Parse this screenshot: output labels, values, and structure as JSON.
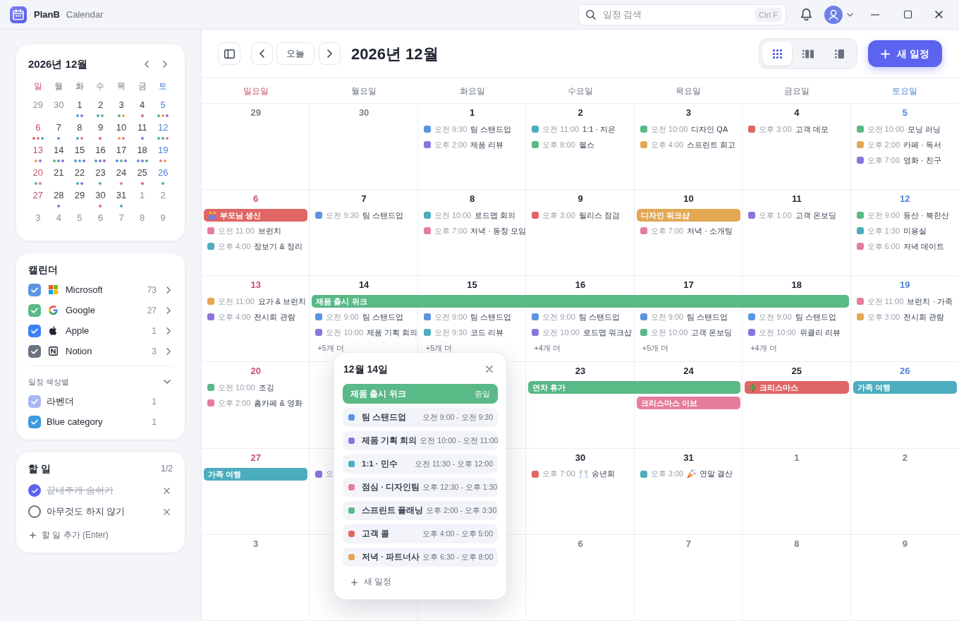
{
  "app": {
    "name": "PlanB",
    "subtitle": "Calendar"
  },
  "search": {
    "placeholder": "일정 검색",
    "shortcut": "Ctrl F"
  },
  "mini_calendar": {
    "title": "2026년 12월",
    "weekdays": [
      {
        "label": "일",
        "kind": "sunday"
      },
      {
        "label": "월",
        "kind": "weekday"
      },
      {
        "label": "화",
        "kind": "weekday"
      },
      {
        "label": "수",
        "kind": "weekday"
      },
      {
        "label": "목",
        "kind": "weekday"
      },
      {
        "label": "금",
        "kind": "weekday"
      },
      {
        "label": "토",
        "kind": "saturday"
      }
    ],
    "weeks": [
      [
        {
          "label": "29",
          "muted": true
        },
        {
          "label": "30",
          "muted": true
        },
        {
          "label": "1",
          "muted": false,
          "dots": [
            {
              "color": "#5b95e2"
            },
            {
              "color": "#8b74dd"
            }
          ]
        },
        {
          "label": "2",
          "muted": false,
          "dots": [
            {
              "color": "#4badbd"
            },
            {
              "color": "#59b987"
            }
          ]
        },
        {
          "label": "3",
          "muted": false,
          "dots": [
            {
              "color": "#59b987"
            },
            {
              "color": "#e2a854"
            }
          ]
        },
        {
          "label": "4",
          "muted": false,
          "dots": [
            {
              "color": "#e06666"
            }
          ]
        },
        {
          "label": "5",
          "muted": false,
          "dots": [
            {
              "color": "#59b987"
            },
            {
              "color": "#e2a854"
            },
            {
              "color": "#8b74dd"
            }
          ]
        }
      ],
      [
        {
          "label": "6",
          "muted": false,
          "dots": [
            {
              "color": "#e06666"
            },
            {
              "color": "#e67c9c"
            },
            {
              "color": "#4badbd"
            }
          ]
        },
        {
          "label": "7",
          "muted": false,
          "dots": [
            {
              "color": "#5b95e2"
            }
          ]
        },
        {
          "label": "8",
          "muted": false,
          "dots": [
            {
              "color": "#4badbd"
            },
            {
              "color": "#e67c9c"
            }
          ]
        },
        {
          "label": "9",
          "muted": false,
          "dots": [
            {
              "color": "#e06666"
            }
          ]
        },
        {
          "label": "10",
          "muted": false,
          "dots": [
            {
              "color": "#e2a854"
            },
            {
              "color": "#e67c9c"
            }
          ]
        },
        {
          "label": "11",
          "muted": false,
          "dots": [
            {
              "color": "#8b74dd"
            }
          ]
        },
        {
          "label": "12",
          "muted": false,
          "dots": [
            {
              "color": "#59b987"
            },
            {
              "color": "#4badbd"
            },
            {
              "color": "#e67c9c"
            }
          ]
        }
      ],
      [
        {
          "label": "13",
          "muted": false,
          "dots": [
            {
              "color": "#e2a854"
            },
            {
              "color": "#8b74dd"
            }
          ]
        },
        {
          "label": "14",
          "muted": false,
          "dots": [
            {
              "color": "#59b987"
            },
            {
              "color": "#5b95e2"
            },
            {
              "color": "#8b74dd"
            }
          ]
        },
        {
          "label": "15",
          "muted": false,
          "dots": [
            {
              "color": "#5b95e2"
            },
            {
              "color": "#4badbd"
            },
            {
              "color": "#8b74dd"
            }
          ]
        },
        {
          "label": "16",
          "muted": false,
          "dots": [
            {
              "color": "#5b95e2"
            },
            {
              "color": "#8b74dd"
            },
            {
              "color": "#8b74dd"
            }
          ]
        },
        {
          "label": "17",
          "muted": false,
          "dots": [
            {
              "color": "#5b95e2"
            },
            {
              "color": "#59b987"
            },
            {
              "color": "#8b74dd"
            }
          ]
        },
        {
          "label": "18",
          "muted": false,
          "dots": [
            {
              "color": "#5b95e2"
            },
            {
              "color": "#8b74dd"
            },
            {
              "color": "#4badbd"
            }
          ]
        },
        {
          "label": "19",
          "muted": false,
          "dots": [
            {
              "color": "#e67c9c"
            },
            {
              "color": "#e2a854"
            }
          ]
        }
      ],
      [
        {
          "label": "20",
          "muted": false,
          "dots": [
            {
              "color": "#59b987"
            },
            {
              "color": "#e67c9c"
            }
          ]
        },
        {
          "label": "21",
          "muted": false
        },
        {
          "label": "22",
          "muted": false,
          "dots": [
            {
              "color": "#4badbd"
            },
            {
              "color": "#8b74dd"
            }
          ]
        },
        {
          "label": "23",
          "muted": false,
          "dots": [
            {
              "color": "#59b987"
            }
          ]
        },
        {
          "label": "24",
          "muted": false,
          "dots": [
            {
              "color": "#e67c9c"
            }
          ]
        },
        {
          "label": "25",
          "muted": false,
          "dots": [
            {
              "color": "#e06666"
            }
          ]
        },
        {
          "label": "26",
          "muted": false,
          "dots": [
            {
              "color": "#4badbd"
            }
          ]
        }
      ],
      [
        {
          "label": "27",
          "muted": false
        },
        {
          "label": "28",
          "muted": false,
          "dots": [
            {
              "color": "#8b74dd"
            }
          ]
        },
        {
          "label": "29",
          "muted": false
        },
        {
          "label": "30",
          "muted": false,
          "dots": [
            {
              "color": "#e06666"
            }
          ]
        },
        {
          "label": "31",
          "muted": false,
          "dots": [
            {
              "color": "#4badbd"
            }
          ]
        },
        {
          "label": "1",
          "muted": true
        },
        {
          "label": "2",
          "muted": true
        }
      ],
      [
        {
          "label": "3",
          "muted": true
        },
        {
          "label": "4",
          "muted": true
        },
        {
          "label": "5",
          "muted": true
        },
        {
          "label": "6",
          "muted": true
        },
        {
          "label": "7",
          "muted": true
        },
        {
          "label": "8",
          "muted": true
        },
        {
          "label": "9",
          "muted": true
        }
      ]
    ]
  },
  "calendars": {
    "title": "캘린더",
    "accounts": [
      {
        "name": "Microsoft",
        "kind": "microsoft",
        "count": "73",
        "checked": true,
        "color": "#5b95e2"
      },
      {
        "name": "Google",
        "kind": "google",
        "count": "27",
        "checked": true,
        "color": "#59b987"
      },
      {
        "name": "Apple",
        "kind": "apple",
        "count": "1",
        "checked": true,
        "color": "#3b82f6"
      },
      {
        "name": "Notion",
        "kind": "notion",
        "count": "3",
        "checked": true,
        "color": "#6b7280"
      }
    ],
    "group": {
      "title": "일정 색상별",
      "expanded": true,
      "items": [
        {
          "name": "라벤더",
          "count": "1",
          "checked": true,
          "color": "#a9b6f4"
        },
        {
          "name": "Blue category",
          "count": "1",
          "checked": true,
          "color": "#3d9ae0"
        }
      ]
    }
  },
  "todo": {
    "title": "할 일",
    "progress": "1/2",
    "items": [
      {
        "text": "끝내주게 숨쉬기",
        "checked": true
      },
      {
        "text": "아무것도 하지 않기",
        "checked": false
      }
    ],
    "add_label": "할 일 추가 (Enter)"
  },
  "toolbar": {
    "today": "오늘",
    "title": "2026년 12월",
    "views": [
      {
        "kind": "month",
        "selected": true
      },
      {
        "kind": "week",
        "selected": false
      },
      {
        "kind": "day",
        "selected": false
      }
    ],
    "new_event": "새 일정"
  },
  "calendar": {
    "weekdays": [
      {
        "label": "일요일",
        "kind": "sunday"
      },
      {
        "label": "월요일",
        "kind": "weekday"
      },
      {
        "label": "화요일",
        "kind": "weekday"
      },
      {
        "label": "수요일",
        "kind": "weekday"
      },
      {
        "label": "목요일",
        "kind": "weekday"
      },
      {
        "label": "금요일",
        "kind": "weekday"
      },
      {
        "label": "토요일",
        "kind": "saturday"
      }
    ],
    "weeks": [
      {
        "sun": {
          "label": "29",
          "muted": true
        },
        "mon": {
          "label": "30",
          "muted": true
        },
        "tue": {
          "label": "1",
          "muted": false,
          "events": [
            {
              "time": "오전 9:30",
              "title": "팀 스탠드업",
              "color": "#5b95e2",
              "kind": "plain"
            },
            {
              "time": "오후 2:00",
              "title": "제품 리뷰",
              "color": "#8b74dd",
              "kind": "plain"
            }
          ]
        },
        "wed": {
          "label": "2",
          "muted": false,
          "events": [
            {
              "time": "오전 11:00",
              "title": "1:1 · 지은",
              "color": "#4badbd",
              "kind": "plain"
            },
            {
              "time": "오후 8:00",
              "title": "헬스",
              "color": "#59b987",
              "kind": "plain"
            }
          ]
        },
        "thu": {
          "label": "3",
          "muted": false,
          "events": [
            {
              "time": "오전 10:00",
              "title": "디자인 QA",
              "color": "#59b987",
              "kind": "plain"
            },
            {
              "time": "오후 4:00",
              "title": "스프린트 회고",
              "color": "#e2a854",
              "kind": "plain"
            }
          ]
        },
        "fri": {
          "label": "4",
          "muted": false,
          "events": [
            {
              "time": "오후 3:00",
              "title": "고객 데모",
              "color": "#e06666",
              "kind": "plain"
            }
          ]
        },
        "sat": {
          "label": "5",
          "muted": false,
          "events": [
            {
              "time": "오전 10:00",
              "title": "모닝 러닝",
              "color": "#59b987",
              "kind": "plain"
            },
            {
              "time": "오후 2:00",
              "title": "카페 · 독서",
              "color": "#e2a854",
              "kind": "plain"
            },
            {
              "time": "오후 7:00",
              "title": "영화 · 친구",
              "color": "#8b74dd",
              "kind": "plain"
            }
          ]
        }
      },
      {
        "sun": {
          "label": "6",
          "muted": false,
          "bars": [
            {
              "kind": "family",
              "title": "부모님 생신",
              "color": "#e06666"
            }
          ],
          "events": [
            {
              "time": "오전 11:00",
              "title": "브런치",
              "color": "#e67c9c",
              "kind": "plain"
            },
            {
              "time": "오후 4:00",
              "title": "장보기 & 정리",
              "color": "#4badbd",
              "kind": "plain"
            }
          ]
        },
        "mon": {
          "label": "7",
          "muted": false,
          "events": [
            {
              "time": "오전 9:30",
              "title": "팀 스탠드업",
              "color": "#5b95e2",
              "kind": "plain"
            }
          ]
        },
        "tue": {
          "label": "8",
          "muted": false,
          "events": [
            {
              "time": "오전 10:00",
              "title": "로드맵 회의",
              "color": "#4badbd",
              "kind": "plain"
            },
            {
              "time": "오후 7:00",
              "title": "저녁 · 동창 모임",
              "color": "#e67c9c",
              "kind": "plain"
            }
          ]
        },
        "wed": {
          "label": "9",
          "muted": false,
          "events": [
            {
              "time": "오후 3:00",
              "title": "릴리스 점검",
              "color": "#e06666",
              "kind": "plain"
            }
          ]
        },
        "thu": {
          "label": "10",
          "muted": false,
          "bars": [
            {
              "kind": "plain",
              "title": "디자인 워크샵",
              "color": "#e2a854"
            }
          ],
          "events": [
            {
              "time": "오후 7:00",
              "title": "저녁 · 소개팅",
              "color": "#e67c9c",
              "kind": "plain"
            }
          ]
        },
        "fri": {
          "label": "11",
          "muted": false,
          "events": [
            {
              "time": "오후 1:00",
              "title": "고객 온보딩",
              "color": "#8b74dd",
              "kind": "plain"
            }
          ]
        },
        "sat": {
          "label": "12",
          "muted": false,
          "events": [
            {
              "time": "오전 9:00",
              "title": "등산 · 북한산",
              "color": "#59b987",
              "kind": "plain"
            },
            {
              "time": "오후 1:30",
              "title": "미용실",
              "color": "#4badbd",
              "kind": "plain"
            },
            {
              "time": "오후 6:00",
              "title": "저녁 데이트",
              "color": "#e67c9c",
              "kind": "plain"
            }
          ]
        }
      },
      {
        "sun": {
          "label": "13",
          "muted": false,
          "events": [
            {
              "time": "오전 11:00",
              "title": "요가 & 브런치",
              "color": "#e2a854",
              "kind": "plain"
            },
            {
              "time": "오후 4:00",
              "title": "전시회 관람",
              "color": "#8b74dd",
              "kind": "plain"
            }
          ]
        },
        "mon": {
          "label": "14",
          "muted": false,
          "bars": [
            {
              "kind": "plain",
              "title": "제품 출시 위크",
              "color": "#59b987"
            }
          ],
          "events": [
            {
              "time": "오전 9:00",
              "title": "팀 스탠드업",
              "color": "#5b95e2",
              "kind": "plain"
            },
            {
              "time": "오전 10:00",
              "title": "제품 기획 회의",
              "color": "#8b74dd",
              "kind": "plain"
            }
          ],
          "more": "+5개 더"
        },
        "tue": {
          "label": "15",
          "muted": false,
          "bars": [
            {
              "kind": "continue"
            }
          ],
          "events": [
            {
              "time": "오전 9:00",
              "title": "팀 스탠드업",
              "color": "#5b95e2",
              "kind": "plain"
            },
            {
              "time": "오전 9:30",
              "title": "코드 리뷰",
              "color": "#4badbd",
              "kind": "plain"
            }
          ],
          "more": "+5개 더"
        },
        "wed": {
          "label": "16",
          "muted": false,
          "bars": [
            {
              "kind": "continue"
            }
          ],
          "events": [
            {
              "time": "오전 9:00",
              "title": "팀 스탠드업",
              "color": "#5b95e2",
              "kind": "plain"
            },
            {
              "time": "오전 10:00",
              "title": "로드맵 워크샵",
              "color": "#8b74dd",
              "kind": "plain"
            }
          ],
          "more": "+4개 더"
        },
        "thu": {
          "label": "17",
          "muted": false,
          "bars": [
            {
              "kind": "continue"
            }
          ],
          "events": [
            {
              "time": "오전 9:00",
              "title": "팀 스탠드업",
              "color": "#5b95e2",
              "kind": "plain"
            },
            {
              "time": "오전 10:00",
              "title": "고객 온보딩",
              "color": "#59b987",
              "kind": "plain"
            }
          ],
          "more": "+5개 더"
        },
        "fri": {
          "label": "18",
          "muted": false,
          "bars": [
            {
              "kind": "continue"
            }
          ],
          "events": [
            {
              "time": "오전 9:00",
              "title": "팀 스탠드업",
              "color": "#5b95e2",
              "kind": "plain"
            },
            {
              "time": "오전 10:00",
              "title": "위클리 리뷰",
              "color": "#8b74dd",
              "kind": "plain"
            }
          ],
          "more": "+4개 더"
        },
        "sat": {
          "label": "19",
          "muted": false,
          "events": [
            {
              "time": "오전 11:00",
              "title": "브런치 · 가족",
              "color": "#e67c9c",
              "kind": "plain"
            },
            {
              "time": "오후 3:00",
              "title": "전시회 관람",
              "color": "#e2a854",
              "kind": "plain"
            }
          ]
        }
      },
      {
        "sun": {
          "label": "20",
          "muted": false,
          "events": [
            {
              "time": "오전 10:00",
              "title": "조깅",
              "color": "#59b987",
              "kind": "plain"
            },
            {
              "time": "오후 2:00",
              "title": "홈카페 & 영화",
              "color": "#e67c9c",
              "kind": "plain"
            }
          ]
        },
        "wed": {
          "label": "23",
          "muted": false,
          "bars": [
            {
              "kind": "plain",
              "title": "연차 휴가",
              "color": "#59b987"
            }
          ]
        },
        "thu": {
          "label": "24",
          "muted": false,
          "bars": [
            {
              "kind": "continue"
            },
            {
              "kind": "plain",
              "title": "크리스마스 이브",
              "color": "#e67c9c"
            }
          ]
        },
        "fri": {
          "label": "25",
          "muted": false,
          "bars": [
            {
              "kind": "tree",
              "title": "크리스마스",
              "color": "#e06666"
            }
          ]
        },
        "sat": {
          "label": "26",
          "muted": false,
          "bars": [
            {
              "kind": "plain",
              "title": "가족 여행",
              "color": "#4badbd"
            }
          ]
        }
      },
      {
        "sun": {
          "label": "27",
          "muted": false,
          "bars": [
            {
              "kind": "plain",
              "title": "가족 여행",
              "color": "#4badbd"
            }
          ]
        },
        "mon": {
          "events": [
            {
              "time": "오",
              "color": "#8b74dd",
              "kind": "plain"
            }
          ]
        },
        "wed": {
          "label": "30",
          "muted": false,
          "events": [
            {
              "time": "오후 7:00",
              "title": "송년회",
              "color": "#e06666",
              "kind": "toast"
            }
          ]
        },
        "thu": {
          "label": "31",
          "muted": false,
          "events": [
            {
              "time": "오후 3:00",
              "title": "연말 결산",
              "color": "#4badbd",
              "kind": "party"
            }
          ]
        },
        "fri": {
          "label": "1",
          "muted": true
        },
        "sat": {
          "label": "2",
          "muted": true
        }
      },
      {
        "sun": {
          "label": "3",
          "muted": true
        },
        "wed": {
          "label": "6",
          "muted": true
        },
        "thu": {
          "label": "7",
          "muted": true
        },
        "fri": {
          "label": "8",
          "muted": true
        },
        "sat": {
          "label": "9",
          "muted": true
        }
      }
    ]
  },
  "day_popup": {
    "title": "12월 14일",
    "all_day": {
      "title": "제품 출시 위크",
      "label": "종일",
      "color": "#59b987"
    },
    "events": [
      {
        "title": "팀 스탠드업",
        "time": "오전 9:00 - 오전 9:30",
        "color": "#5b95e2"
      },
      {
        "title": "제품 기획 회의",
        "time": "오전 10:00 - 오전 11:00",
        "color": "#8b74dd"
      },
      {
        "title": "1:1 · 민수",
        "time": "오전 11:30 - 오후 12:00",
        "color": "#4badbd"
      },
      {
        "title": "점심 · 디자인팀",
        "time": "오후 12:30 - 오후 1:30",
        "color": "#e67c9c"
      },
      {
        "title": "스프린트 플래닝",
        "time": "오후 2:00 - 오후 3:30",
        "color": "#59b987"
      },
      {
        "title": "고객 콜",
        "time": "오후 4:00 - 오후 5:00",
        "color": "#e06666"
      },
      {
        "title": "저녁 · 파트너사",
        "time": "오후 6:30 - 오후 8:00",
        "color": "#e2a854"
      }
    ],
    "add_label": "새 일정"
  }
}
